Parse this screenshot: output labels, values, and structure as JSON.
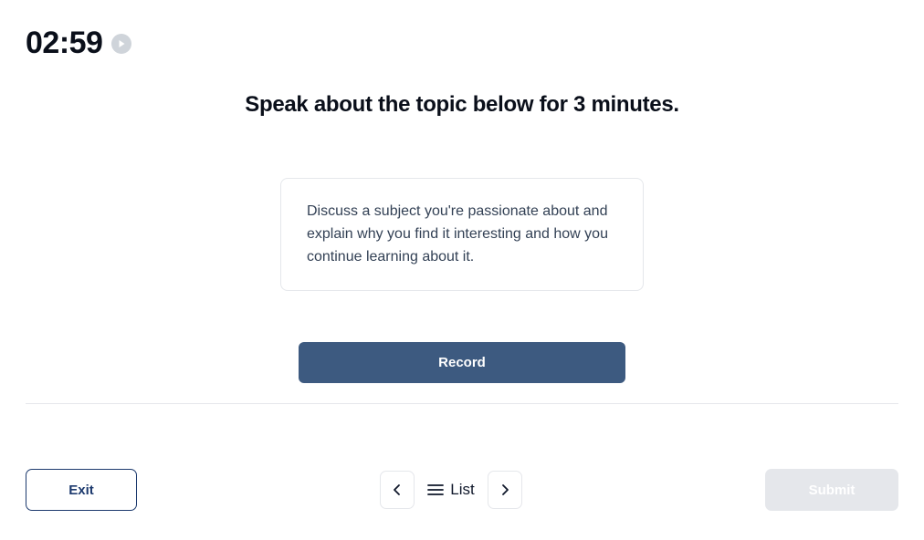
{
  "timer": {
    "value": "02:59"
  },
  "instruction": "Speak about the topic below for 3 minutes.",
  "prompt": "Discuss a subject you're passionate about and explain why you find it interesting and how you continue learning about it.",
  "actions": {
    "record": "Record",
    "exit": "Exit",
    "list": "List",
    "submit": "Submit"
  }
}
